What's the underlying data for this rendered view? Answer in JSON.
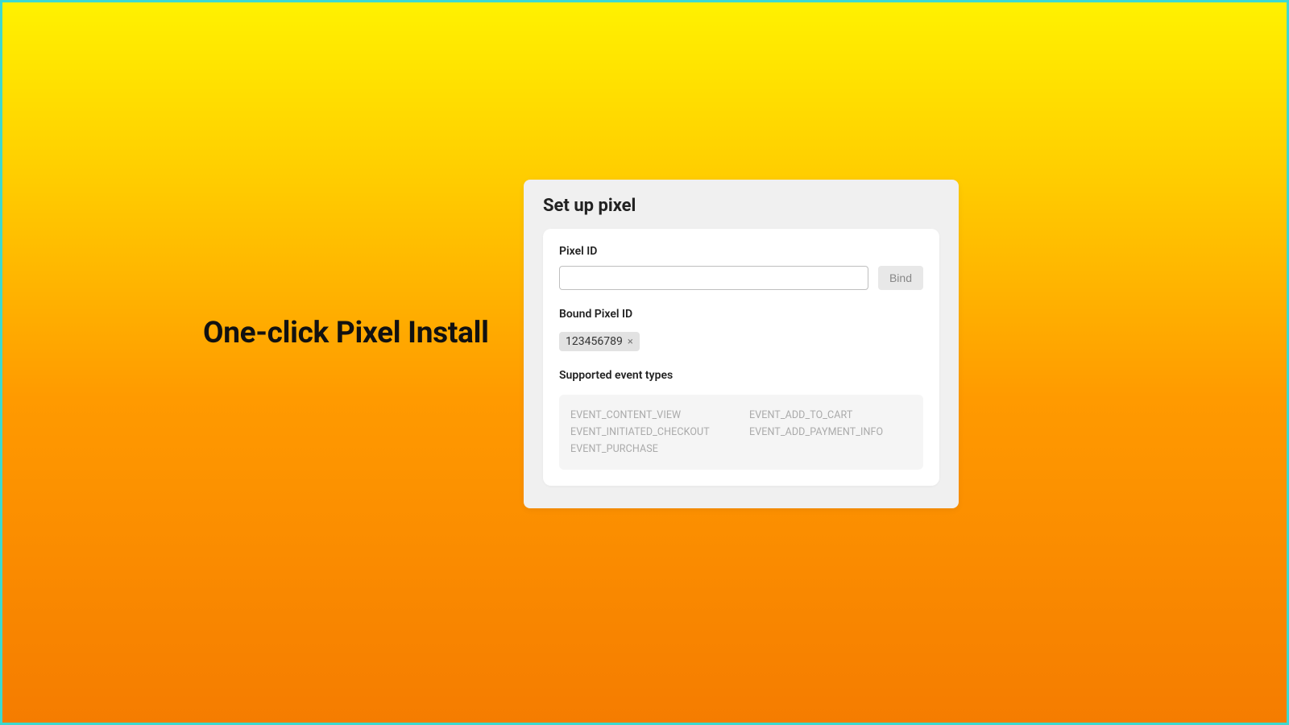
{
  "headline": "One-click Pixel Install",
  "card": {
    "title": "Set up pixel",
    "pixel_id_label": "Pixel ID",
    "pixel_id_value": "",
    "bind_button": "Bind",
    "bound_label": "Bound Pixel ID",
    "bound_pixel": "123456789",
    "supported_label": "Supported event types",
    "events": [
      "EVENT_CONTENT_VIEW",
      "EVENT_ADD_TO_CART",
      "EVENT_INITIATED_CHECKOUT",
      "EVENT_ADD_PAYMENT_INFO",
      "EVENT_PURCHASE"
    ]
  }
}
